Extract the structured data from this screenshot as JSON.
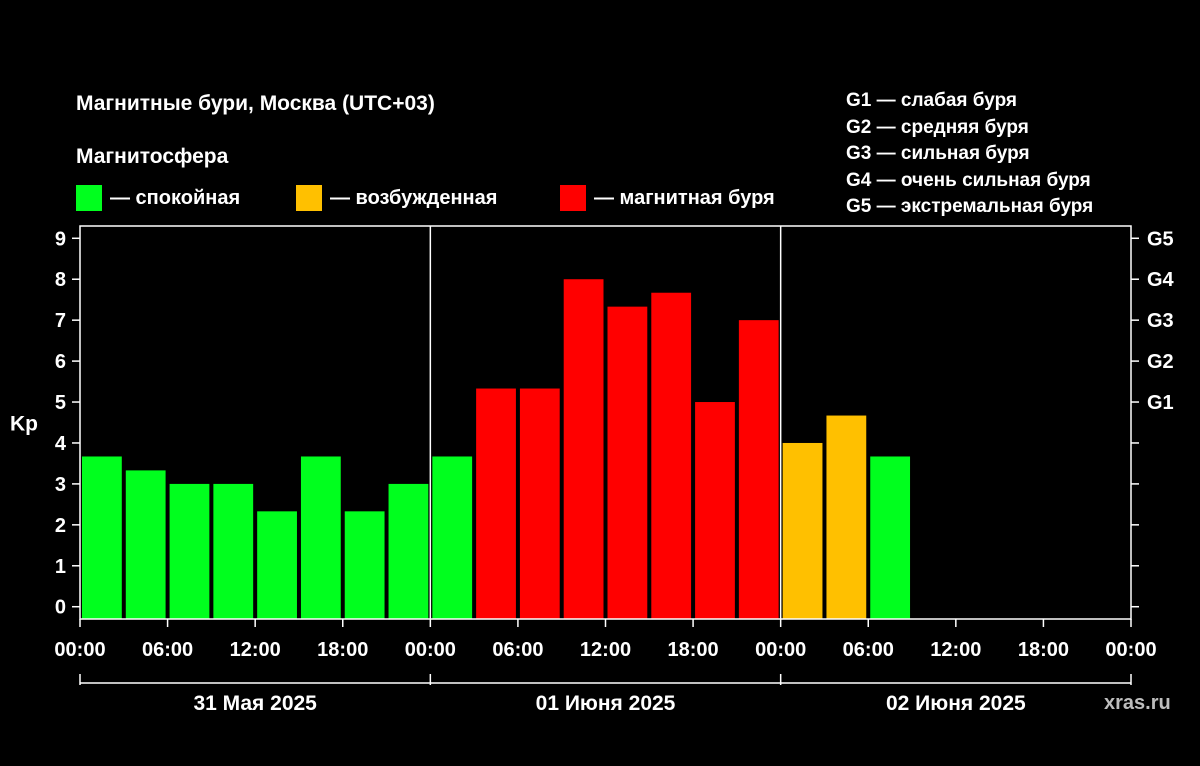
{
  "chart_data": {
    "type": "bar",
    "title": "Магнитные бури, Москва (UTC+03)",
    "subtitle": "Магнитосфера",
    "ylabel": "Kp",
    "ylim": [
      -0.3,
      9.3
    ],
    "yticks": [
      "0",
      "1",
      "2",
      "3",
      "4",
      "5",
      "6",
      "7",
      "8",
      "9"
    ],
    "xticks": [
      "00:00",
      "06:00",
      "12:00",
      "18:00",
      "00:00",
      "06:00",
      "12:00",
      "18:00",
      "00:00",
      "06:00",
      "12:00",
      "18:00",
      "00:00"
    ],
    "days": [
      "31 Мая 2025",
      "01 Июня 2025",
      "02 Июня 2025"
    ],
    "x_range_hours": [
      0,
      72
    ],
    "bar_interval_hours": 3,
    "g_axis": [
      {
        "label": "G5",
        "kp": 9
      },
      {
        "label": "G4",
        "kp": 8
      },
      {
        "label": "G3",
        "kp": 7
      },
      {
        "label": "G2",
        "kp": 6
      },
      {
        "label": "G1",
        "kp": 5
      }
    ],
    "colors": {
      "calm": "#00ff1e",
      "excited": "#ffc000",
      "storm": "#ff0000"
    },
    "series": [
      {
        "values": [
          3.67,
          3.33,
          3.0,
          3.0,
          2.33,
          3.67,
          2.33,
          3.0,
          3.67,
          5.33,
          5.33,
          8.0,
          7.33,
          7.67,
          5.0,
          7.0,
          4.0,
          4.67,
          3.67
        ],
        "states": [
          "calm",
          "calm",
          "calm",
          "calm",
          "calm",
          "calm",
          "calm",
          "calm",
          "calm",
          "storm",
          "storm",
          "storm",
          "storm",
          "storm",
          "storm",
          "storm",
          "excited",
          "excited",
          "calm"
        ]
      }
    ],
    "legend": [
      {
        "color": "#00ff1e",
        "label": "— спокойная"
      },
      {
        "color": "#ffc000",
        "label": "— возбужденная"
      },
      {
        "color": "#ff0000",
        "label": "— магнитная буря"
      }
    ],
    "legend_position": "top-left"
  },
  "scale_legend": [
    "G1 — слабая буря",
    "G2 — средняя буря",
    "G3 — сильная буря",
    "G4 — очень сильная буря",
    "G5 — экстремальная буря"
  ],
  "watermark": "xras.ru"
}
